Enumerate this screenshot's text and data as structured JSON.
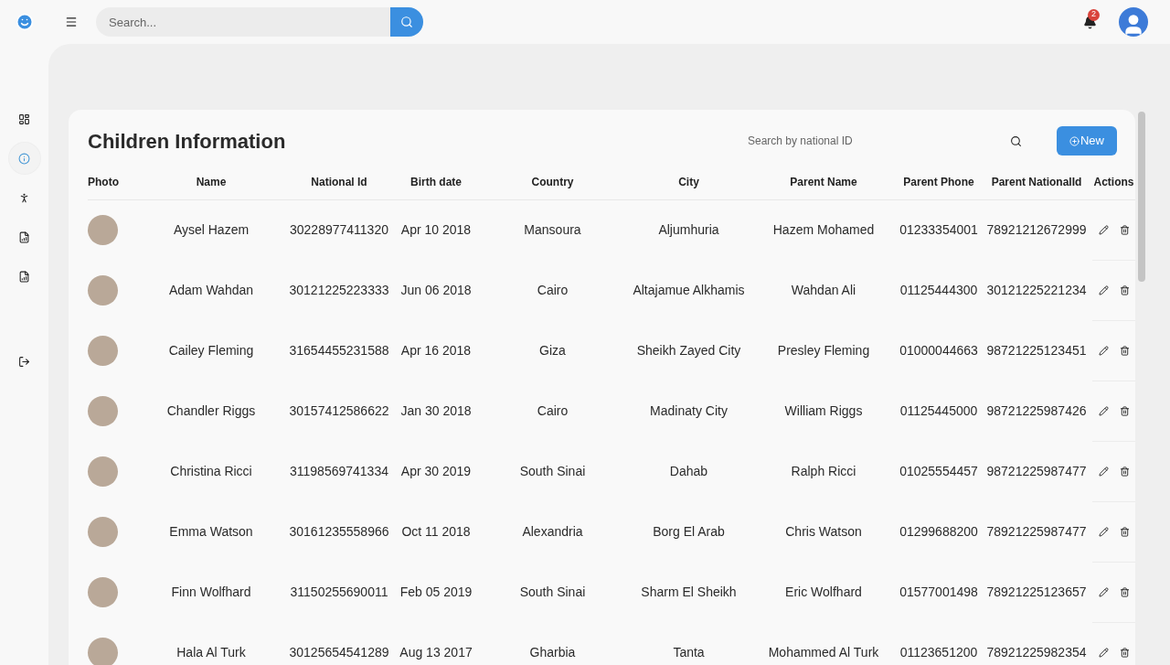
{
  "topbar": {
    "search": {
      "placeholder": "Search..."
    },
    "notifications": {
      "count": "2"
    }
  },
  "sidebar": {
    "items": [
      {
        "kind": "dashboard",
        "selected": false
      },
      {
        "kind": "info",
        "selected": true
      },
      {
        "kind": "person",
        "selected": false
      },
      {
        "kind": "report",
        "selected": false
      },
      {
        "kind": "report",
        "selected": false
      },
      {
        "kind": "logout",
        "selected": false
      }
    ]
  },
  "card": {
    "title": "Children Information",
    "search": {
      "placeholder": "Search by national ID"
    },
    "new_button": "New"
  },
  "table": {
    "columns": [
      "Photo",
      "Name",
      "National Id",
      "Birth date",
      "Country",
      "City",
      "Parent Name",
      "Parent Phone",
      "Parent NationalId",
      "Actions"
    ],
    "rows": [
      {
        "name": "Aysel Hazem",
        "national_id": "30228977411320",
        "birth_date": "Apr 10 2018",
        "country": "Mansoura",
        "city": "Aljumhuria",
        "parent_name": "Hazem Mohamed",
        "parent_phone": "01233354001",
        "parent_national_id": "78921212672999"
      },
      {
        "name": "Adam Wahdan",
        "national_id": "30121225223333",
        "birth_date": "Jun 06 2018",
        "country": "Cairo",
        "city": "Altajamue Alkhamis",
        "parent_name": "Wahdan Ali",
        "parent_phone": "01125444300",
        "parent_national_id": "30121225221234"
      },
      {
        "name": "Cailey Fleming",
        "national_id": "31654455231588",
        "birth_date": "Apr 16 2018",
        "country": "Giza",
        "city": "Sheikh Zayed City",
        "parent_name": "Presley Fleming",
        "parent_phone": "01000044663",
        "parent_national_id": "98721225123451"
      },
      {
        "name": "Chandler Riggs",
        "national_id": "30157412586622",
        "birth_date": "Jan 30 2018",
        "country": "Cairo",
        "city": "Madinaty City",
        "parent_name": "William Riggs",
        "parent_phone": "01125445000",
        "parent_national_id": "98721225987426"
      },
      {
        "name": "Christina Ricci",
        "national_id": "31198569741334",
        "birth_date": "Apr 30 2019",
        "country": "South Sinai",
        "city": "Dahab",
        "parent_name": "Ralph Ricci",
        "parent_phone": "01025554457",
        "parent_national_id": "98721225987477"
      },
      {
        "name": "Emma Watson",
        "national_id": "30161235558966",
        "birth_date": "Oct 11 2018",
        "country": "Alexandria",
        "city": "Borg El Arab",
        "parent_name": "Chris Watson",
        "parent_phone": "01299688200",
        "parent_national_id": "78921225987477"
      },
      {
        "name": "Finn Wolfhard",
        "national_id": "31150255690011",
        "birth_date": "Feb 05 2019",
        "country": "South Sinai",
        "city": "Sharm El Sheikh",
        "parent_name": "Eric Wolfhard",
        "parent_phone": "01577001498",
        "parent_national_id": "78921225123657"
      },
      {
        "name": "Hala Al Turk",
        "national_id": "30125654541289",
        "birth_date": "Aug 13 2017",
        "country": "Gharbia",
        "city": "Tanta",
        "parent_name": "Mohammed Al Turk",
        "parent_phone": "01123651200",
        "parent_national_id": "78921225982354"
      }
    ]
  }
}
